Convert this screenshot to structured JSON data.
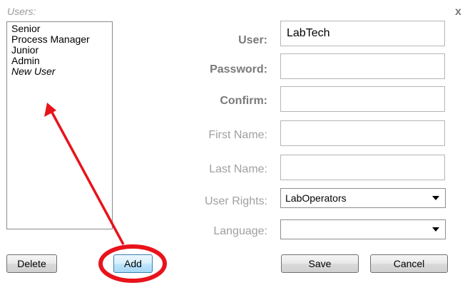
{
  "users_panel": {
    "label": "Users:",
    "items": [
      "Senior",
      "Process Manager",
      "Junior",
      "Admin",
      "New User"
    ]
  },
  "buttons": {
    "delete": "Delete",
    "add": "Add",
    "save": "Save",
    "cancel": "Cancel"
  },
  "close": {
    "glyph": "x"
  },
  "form": {
    "user": {
      "label": "User:",
      "value": "LabTech"
    },
    "password": {
      "label": "Password:",
      "value": ""
    },
    "confirm": {
      "label": "Confirm:",
      "value": ""
    },
    "first_name": {
      "label": "First Name:",
      "value": ""
    },
    "last_name": {
      "label": "Last Name:",
      "value": ""
    },
    "user_rights": {
      "label": "User Rights:",
      "selected": "LabOperators"
    },
    "language": {
      "label": "Language:",
      "selected": ""
    }
  },
  "icons": {
    "dropdown": "chevron-down-icon",
    "close": "close-icon"
  },
  "colors": {
    "annotation": "#e8131b",
    "label_bold": "#7a7a7a",
    "label_light": "#a0a0a0",
    "hover_button_border": "#3c7fb1"
  }
}
